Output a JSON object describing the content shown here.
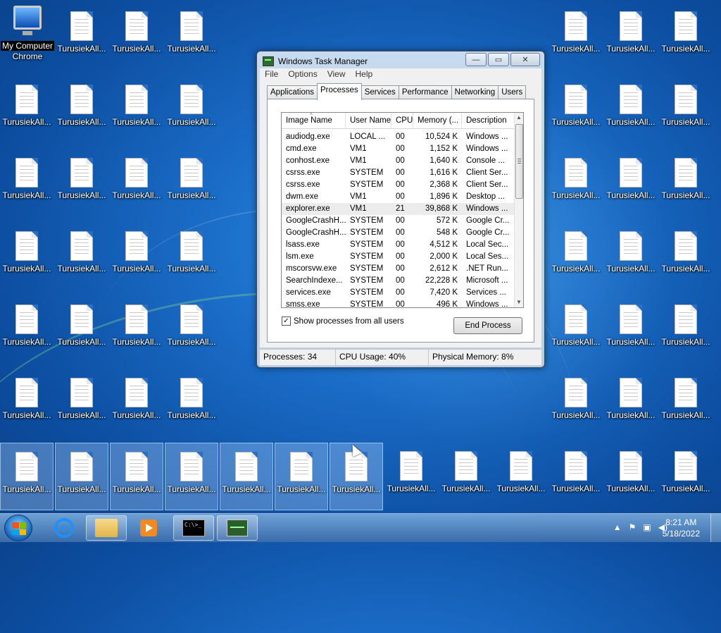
{
  "desktop": {
    "my_computer_label_top": "My Computer",
    "my_computer_label_bottom": "Chrome",
    "file_icon_label": "TurusiekAll..."
  },
  "task_manager": {
    "title": "Windows Task Manager",
    "menu": [
      "File",
      "Options",
      "View",
      "Help"
    ],
    "tabs": [
      "Applications",
      "Processes",
      "Services",
      "Performance",
      "Networking",
      "Users"
    ],
    "active_tab": "Processes",
    "columns": [
      "Image Name",
      "User Name",
      "CPU",
      "Memory (...",
      "Description"
    ],
    "processes": [
      {
        "image": "audiodg.exe",
        "user": "LOCAL ...",
        "cpu": "00",
        "mem": "10,524 K",
        "desc": "Windows ..."
      },
      {
        "image": "cmd.exe",
        "user": "VM1",
        "cpu": "00",
        "mem": "1,152 K",
        "desc": "Windows ..."
      },
      {
        "image": "conhost.exe",
        "user": "VM1",
        "cpu": "00",
        "mem": "1,640 K",
        "desc": "Console ..."
      },
      {
        "image": "csrss.exe",
        "user": "SYSTEM",
        "cpu": "00",
        "mem": "1,616 K",
        "desc": "Client Ser..."
      },
      {
        "image": "csrss.exe",
        "user": "SYSTEM",
        "cpu": "00",
        "mem": "2,368 K",
        "desc": "Client Ser..."
      },
      {
        "image": "dwm.exe",
        "user": "VM1",
        "cpu": "00",
        "mem": "1,896 K",
        "desc": "Desktop ..."
      },
      {
        "image": "explorer.exe",
        "user": "VM1",
        "cpu": "21",
        "mem": "39,868 K",
        "desc": "Windows ..."
      },
      {
        "image": "GoogleCrashH...",
        "user": "SYSTEM",
        "cpu": "00",
        "mem": "572 K",
        "desc": "Google Cr..."
      },
      {
        "image": "GoogleCrashH...",
        "user": "SYSTEM",
        "cpu": "00",
        "mem": "548 K",
        "desc": "Google Cr..."
      },
      {
        "image": "lsass.exe",
        "user": "SYSTEM",
        "cpu": "00",
        "mem": "4,512 K",
        "desc": "Local Sec..."
      },
      {
        "image": "lsm.exe",
        "user": "SYSTEM",
        "cpu": "00",
        "mem": "2,000 K",
        "desc": "Local Ses..."
      },
      {
        "image": "mscorsvw.exe",
        "user": "SYSTEM",
        "cpu": "00",
        "mem": "2,612 K",
        "desc": ".NET Run..."
      },
      {
        "image": "SearchIndexe...",
        "user": "SYSTEM",
        "cpu": "00",
        "mem": "22,228 K",
        "desc": "Microsoft ..."
      },
      {
        "image": "services.exe",
        "user": "SYSTEM",
        "cpu": "00",
        "mem": "7,420 K",
        "desc": "Services ..."
      },
      {
        "image": "smss.exe",
        "user": "SYSTEM",
        "cpu": "00",
        "mem": "496 K",
        "desc": "Windows ..."
      }
    ],
    "selected_row": "explorer.exe",
    "show_all_label": "Show processes from all users",
    "show_all_checked": true,
    "check_mark": "✓",
    "end_process_label": "End Process",
    "status": {
      "processes": "Processes: 34",
      "cpu": "CPU Usage: 40%",
      "memory": "Physical Memory: 8%"
    }
  },
  "taskbar": {
    "time": "8:21 AM",
    "date": "5/18/2022",
    "cmd_glyph": "C:\\>_",
    "ie_glyph": "e",
    "tray_arrow": "▲",
    "tray_flag": "⚑",
    "tray_network": "▣",
    "tray_volume": "◀)"
  },
  "colors": {
    "desktop_bg": "#1a6cc6",
    "selected_row": "#ececec"
  }
}
